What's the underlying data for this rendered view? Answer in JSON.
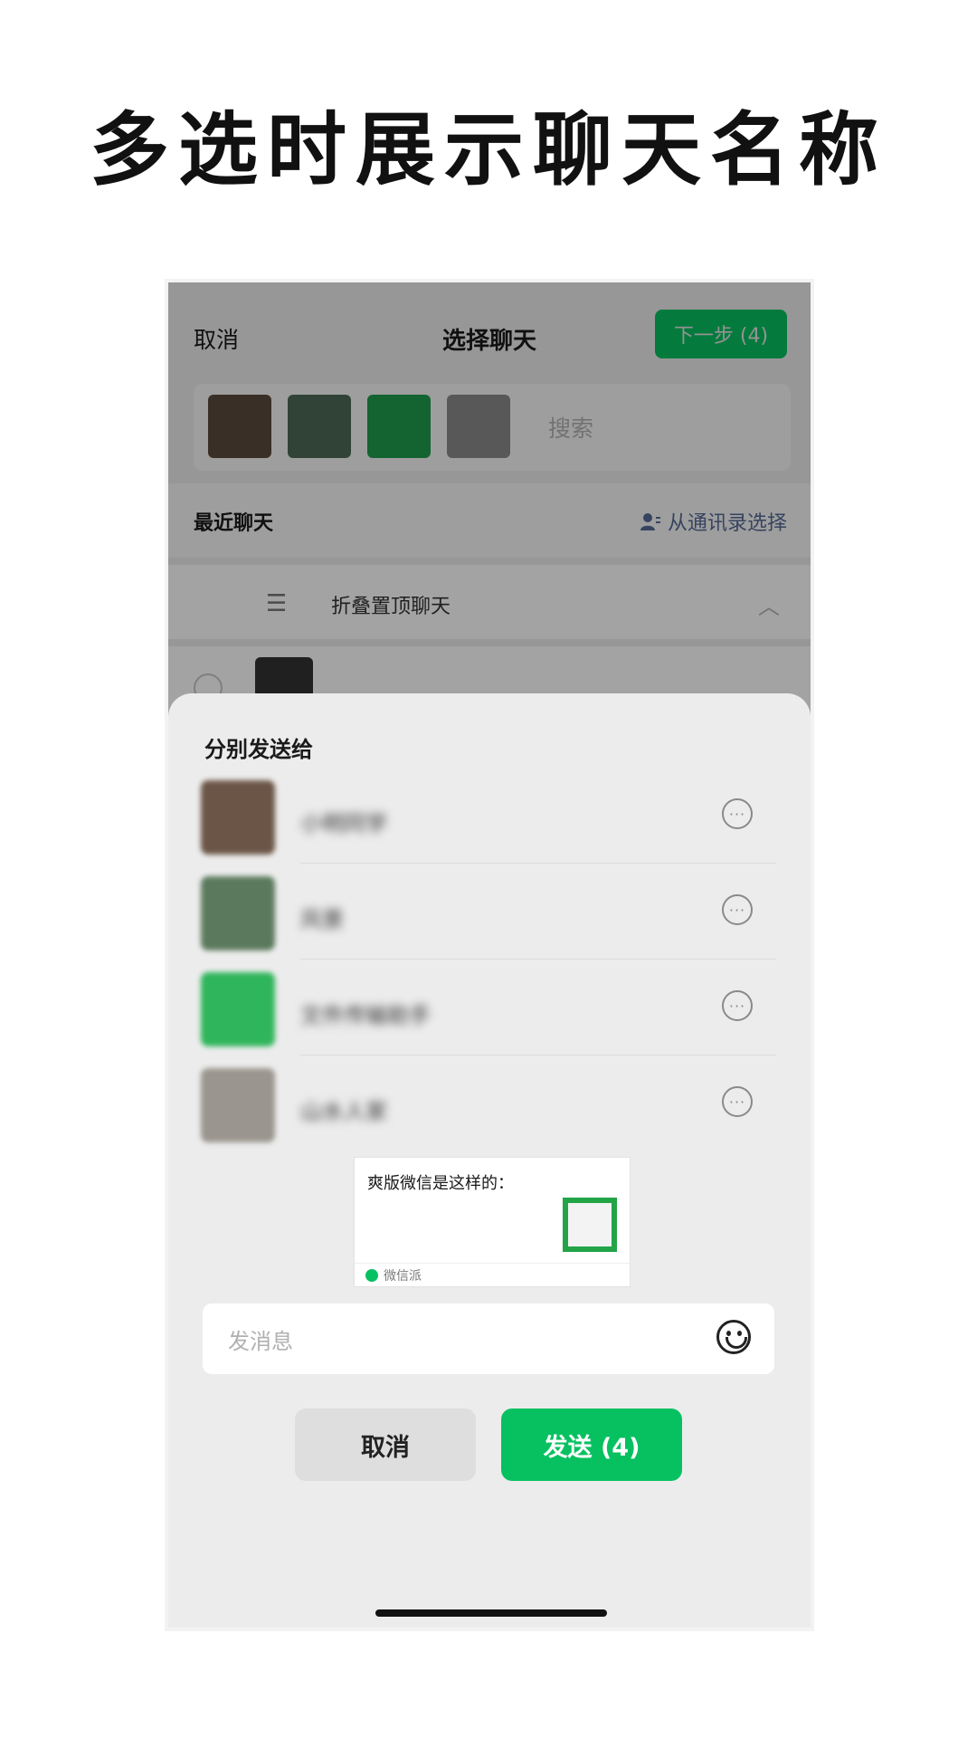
{
  "headline": "多选时展示聊天名称",
  "navbar": {
    "cancel_label": "取消",
    "title": "选择聊天",
    "next_label": "下一步 (4)"
  },
  "search": {
    "placeholder": "搜索",
    "selected_avatar_colors": [
      "#5b4a3c",
      "#4e6a55",
      "#1f9d4d",
      "#8a8a8a"
    ]
  },
  "recent_section": {
    "label": "最近聊天",
    "pick_from_contacts_label": "从通讯录选择"
  },
  "fold_row": {
    "label": "折叠置顶聊天"
  },
  "sheet": {
    "title": "分别发送给",
    "recipients": [
      {
        "name": "小明同学",
        "avatar_color": "#6b5546"
      },
      {
        "name": "风景",
        "avatar_color": "#5b7a5d"
      },
      {
        "name": "文件传输助手",
        "avatar_color": "#2fb55b"
      },
      {
        "name": "山水人家",
        "avatar_color": "#9a958e"
      }
    ],
    "card": {
      "title": "爽版微信是这样的：",
      "source": "微信派"
    },
    "message_placeholder": "发消息",
    "cancel_label": "取消",
    "send_label": "发送 (4)"
  },
  "colors": {
    "accent": "#07c160",
    "link": "#576b95",
    "sheet_bg": "#ececec"
  },
  "icons": [
    "contacts-icon",
    "list-icon",
    "chevron-up-icon",
    "more-icon",
    "emoji-icon",
    "wechat-logo-icon"
  ]
}
